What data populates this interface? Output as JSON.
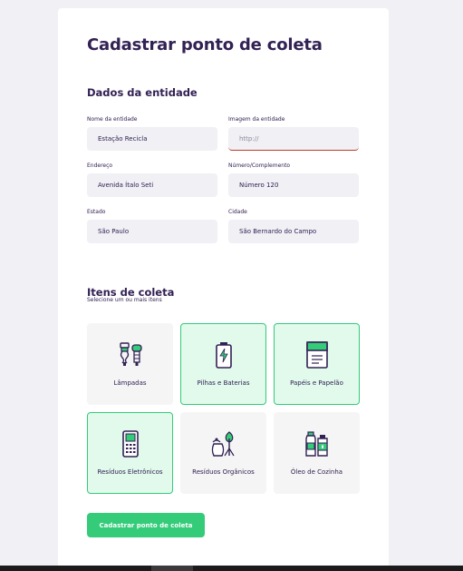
{
  "form": {
    "title": "Cadastrar ponto de coleta",
    "entity_section": "Dados da entidade",
    "fields": {
      "name_label": "Nome da entidade",
      "name_value": "Estação Recicla",
      "image_label": "Imagem da entidade",
      "image_placeholder": "http://",
      "address_label": "Endereço",
      "address_value": "Avenida Ítalo Seti",
      "number_label": "Número/Complemento",
      "number_value": "Número 120",
      "state_label": "Estado",
      "state_value": "São Paulo",
      "city_label": "Cidade",
      "city_value": "São Bernardo do Campo"
    },
    "items_section": "Itens de coleta",
    "items_subtitle": "Selecione um ou mais itens",
    "items": [
      {
        "label": "Lâmpadas",
        "selected": false,
        "icon": "lamps-icon"
      },
      {
        "label": "Pilhas e Baterias",
        "selected": true,
        "icon": "battery-icon"
      },
      {
        "label": "Papéis e Papelão",
        "selected": true,
        "icon": "paper-icon"
      },
      {
        "label": "Resíduos Eletrônicos",
        "selected": true,
        "icon": "electronics-icon"
      },
      {
        "label": "Resíduos Orgânicos",
        "selected": false,
        "icon": "organic-waste-icon"
      },
      {
        "label": "Óleo de Cozinha",
        "selected": false,
        "icon": "cooking-oil-icon"
      }
    ],
    "submit_label": "Cadastrar ponto de coleta"
  },
  "colors": {
    "primary": "#34cb79",
    "title": "#322153",
    "field_bg": "#f0f0f5",
    "selected_bg": "#e1faec"
  }
}
